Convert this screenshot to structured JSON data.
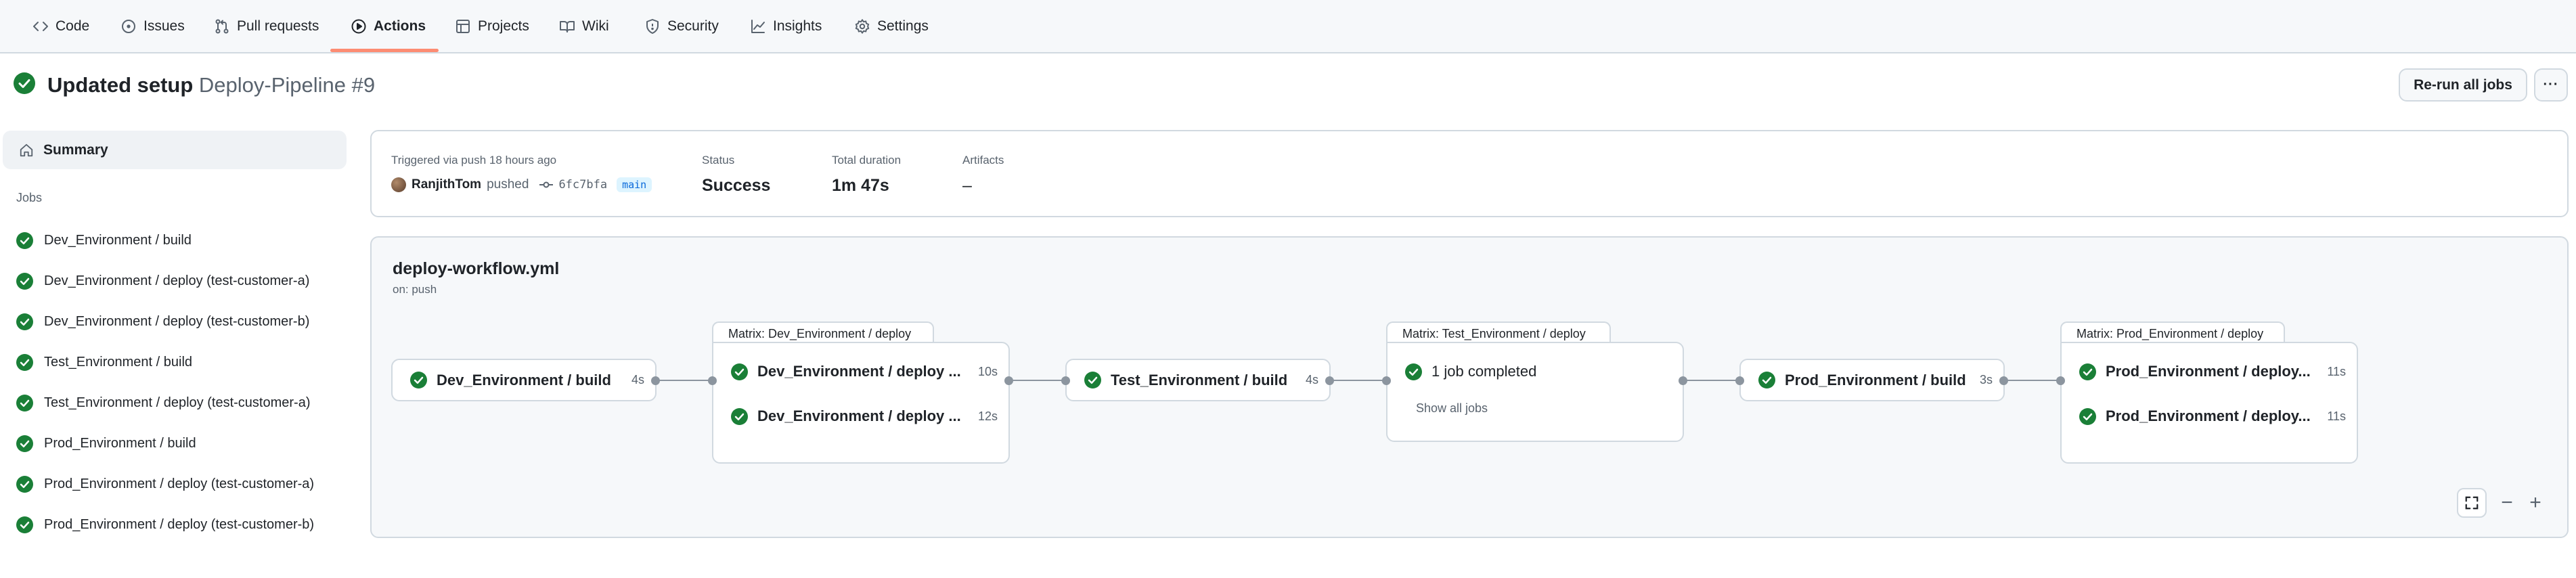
{
  "nav": {
    "tabs": [
      {
        "label": "Code",
        "icon": "code-icon"
      },
      {
        "label": "Issues",
        "icon": "issue-icon"
      },
      {
        "label": "Pull requests",
        "icon": "pull-request-icon"
      },
      {
        "label": "Actions",
        "icon": "play-icon",
        "selected": true
      },
      {
        "label": "Projects",
        "icon": "table-icon"
      },
      {
        "label": "Wiki",
        "icon": "book-icon"
      },
      {
        "label": "Security",
        "icon": "shield-icon"
      },
      {
        "label": "Insights",
        "icon": "graph-icon"
      },
      {
        "label": "Settings",
        "icon": "gear-icon"
      }
    ]
  },
  "header": {
    "title": "Updated setup",
    "workflow_name": "Deploy-Pipeline #9",
    "rerun_label": "Re-run all jobs",
    "more_label": "···"
  },
  "sidebar": {
    "summary_label": "Summary",
    "jobs_heading": "Jobs",
    "jobs": [
      {
        "label": "Dev_Environment / build",
        "status": "success"
      },
      {
        "label": "Dev_Environment / deploy (test-customer-a)",
        "status": "success"
      },
      {
        "label": "Dev_Environment / deploy (test-customer-b)",
        "status": "success"
      },
      {
        "label": "Test_Environment / build",
        "status": "success"
      },
      {
        "label": "Test_Environment / deploy (test-customer-a)",
        "status": "success"
      },
      {
        "label": "Prod_Environment / build",
        "status": "success"
      },
      {
        "label": "Prod_Environment / deploy (test-customer-a)",
        "status": "success"
      },
      {
        "label": "Prod_Environment / deploy (test-customer-b)",
        "status": "success"
      }
    ]
  },
  "trigger": {
    "triggered_text": "Triggered via push 18 hours ago",
    "user": "RanjithTom",
    "action": "pushed",
    "commit": "6fc7bfa",
    "branch": "main",
    "status_label": "Status",
    "status_value": "Success",
    "duration_label": "Total duration",
    "duration_value": "1m 47s",
    "artifacts_label": "Artifacts",
    "artifacts_value": "–"
  },
  "workflow": {
    "file": "deploy-workflow.yml",
    "event": "on: push",
    "nodes": {
      "dev_build": {
        "label": "Dev_Environment / build",
        "duration": "4s"
      },
      "dev_matrix": {
        "tab": "Matrix: Dev_Environment / deploy",
        "jobs": [
          {
            "label": "Dev_Environment / deploy ...",
            "duration": "10s"
          },
          {
            "label": "Dev_Environment / deploy ...",
            "duration": "12s"
          }
        ]
      },
      "test_build": {
        "label": "Test_Environment / build",
        "duration": "4s"
      },
      "test_matrix": {
        "tab": "Matrix: Test_Environment / deploy",
        "summary": "1 job completed",
        "show_all": "Show all jobs"
      },
      "prod_build": {
        "label": "Prod_Environment / build",
        "duration": "3s"
      },
      "prod_matrix": {
        "tab": "Matrix: Prod_Environment / deploy",
        "jobs": [
          {
            "label": "Prod_Environment / deploy...",
            "duration": "11s"
          },
          {
            "label": "Prod_Environment / deploy...",
            "duration": "11s"
          }
        ]
      }
    },
    "controls": {
      "zoom_out": "−",
      "zoom_in": "+"
    }
  },
  "colors": {
    "success": "#1a7f37",
    "accent_underline": "#fd8c73",
    "border": "#d1d9e0",
    "muted": "#59636e",
    "link": "#0969da"
  }
}
